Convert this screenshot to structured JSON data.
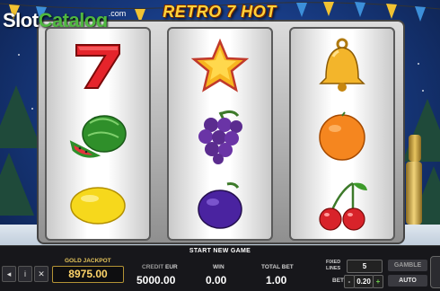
{
  "logo": {
    "slot": "Slot",
    "catalog": "Catalog",
    "com": ".com"
  },
  "game_title": "RETRO 7 HOT",
  "reels": [
    [
      "seven-symbol",
      "watermelon-symbol",
      "lemon-symbol"
    ],
    [
      "star-symbol",
      "grapes-symbol",
      "plum-symbol"
    ],
    [
      "bell-symbol",
      "orange-symbol",
      "cherries-symbol"
    ]
  ],
  "status_message": "START NEW GAME",
  "gold_jackpot": {
    "label": "GOLD JACKPOT",
    "value": "8975.00"
  },
  "credit": {
    "label": "CREDIT",
    "currency": "EUR",
    "value": "5000.00"
  },
  "win": {
    "label": "WIN",
    "value": "0.00"
  },
  "total_bet": {
    "label": "TOTAL BET",
    "value": "1.00"
  },
  "fixed_lines": {
    "label": "FIXED LINES",
    "value": "5"
  },
  "bet": {
    "label": "BET",
    "value": "0.20",
    "minus": "-",
    "plus": "+"
  },
  "buttons": {
    "gamble": "GAMBLE",
    "auto": "AUTO",
    "sound": "◂",
    "info": "i",
    "close": "✕"
  },
  "colors": {
    "jackpot_gold": "#ffd56a",
    "accent_green": "#4fb840",
    "title_gold": "#ffd23a"
  }
}
